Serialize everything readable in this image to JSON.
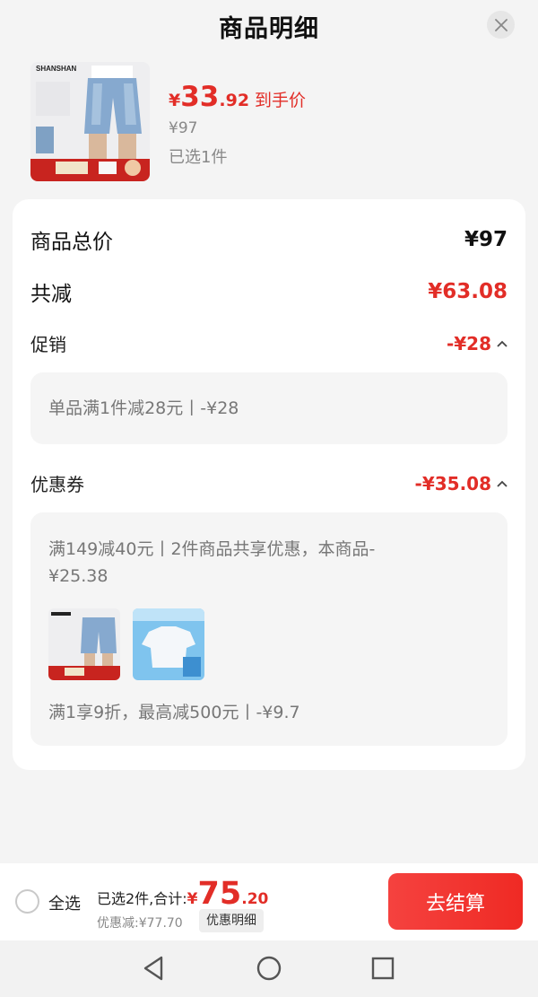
{
  "header": {
    "title": "商品明细",
    "close_icon": "close-icon"
  },
  "product": {
    "brand": "SHANSHAN",
    "price_currency": "¥",
    "price_int": "33",
    "price_dec": ".92",
    "price_tag": "到手价",
    "original_price": "¥97",
    "selected": "已选1件"
  },
  "breakdown": {
    "total_label": "商品总价",
    "total_value": "¥97",
    "reduce_label": "共减",
    "reduce_value": "¥63.08",
    "promo_label": "促销",
    "promo_value": "-¥28",
    "promo_detail": "单品满1件减28元丨-¥28",
    "coupon_label": "优惠券",
    "coupon_value": "-¥35.08",
    "coupon_detail_1": "满149减40元丨2件商品共享优惠，本商品-¥25.38",
    "coupon_detail_2": "满1享9折，最高减500元丨-¥9.7"
  },
  "bottom": {
    "select_all": "全选",
    "selected_total_label": "已选2件,合计:",
    "total_currency": "¥",
    "total_int": "75",
    "total_dec": ".20",
    "discount_text": "优惠减:¥77.70",
    "detail_button": "优惠明细",
    "checkout_button": "去结算"
  },
  "colors": {
    "accent_red": "#e22d27",
    "button_red": "#ef2a24"
  }
}
